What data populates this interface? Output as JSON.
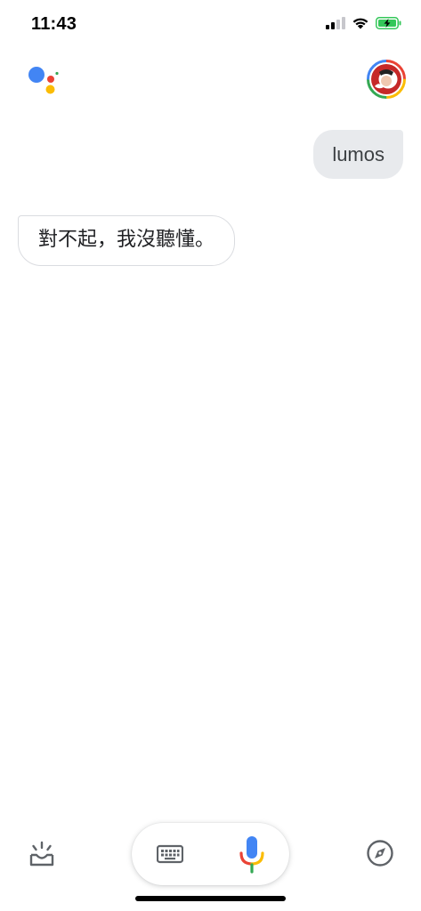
{
  "status_bar": {
    "time": "11:43",
    "icons": [
      "cellular-signal-icon",
      "wifi-icon",
      "battery-charging-icon"
    ]
  },
  "header": {
    "logo": "google-assistant-dots-icon",
    "avatar": "user-avatar"
  },
  "conversation": {
    "user_message": "lumos",
    "assistant_reply": "對不起，我沒聽懂。"
  },
  "bottom_bar": {
    "left_icon": "updates-tray-icon",
    "keyboard_icon": "keyboard-icon",
    "mic_icon": "microphone-icon",
    "right_icon": "explore-compass-icon"
  },
  "colors": {
    "google_blue": "#4285f4",
    "google_red": "#ea4335",
    "google_yellow": "#fbbc04",
    "google_green": "#34a853",
    "battery_green": "#34c759",
    "user_bubble": "#e8eaed"
  }
}
